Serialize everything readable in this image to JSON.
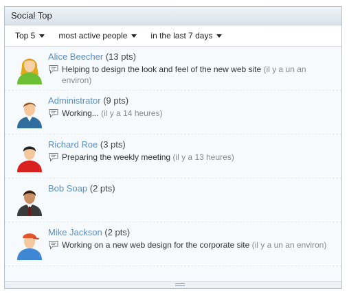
{
  "widget": {
    "title": "Social Top"
  },
  "filters": {
    "count": "Top 5",
    "metric": "most active people",
    "period": "in the last 7 days"
  },
  "items": [
    {
      "name": "Alice Beecher",
      "points": "(13 pts)",
      "status": "Helping to design the look and feel of the new web site",
      "time": "(il y a un an environ)",
      "avatar": "female-user-avatar"
    },
    {
      "name": "Administrator",
      "points": "(9 pts)",
      "status": "Working...",
      "time": "(il y a 14 heures)",
      "avatar": "male-user-avatar"
    },
    {
      "name": "Richard Roe",
      "points": "(3 pts)",
      "status": "Preparing the weekly meeting",
      "time": "(il y a 13 heures)",
      "avatar": "user-red-shirt-avatar"
    },
    {
      "name": "Bob Soap",
      "points": "(2 pts)",
      "avatar": "businessman-avatar"
    },
    {
      "name": "Mike Jackson",
      "points": "(2 pts)",
      "status": "Working on a new web design for the corporate site",
      "time": "(il y a un an environ)",
      "avatar": "user-cap-avatar"
    }
  ],
  "icons": {
    "status": "speech-bubble-icon",
    "dropdown": "caret-down-icon",
    "resize": "resize-grip-icon"
  }
}
